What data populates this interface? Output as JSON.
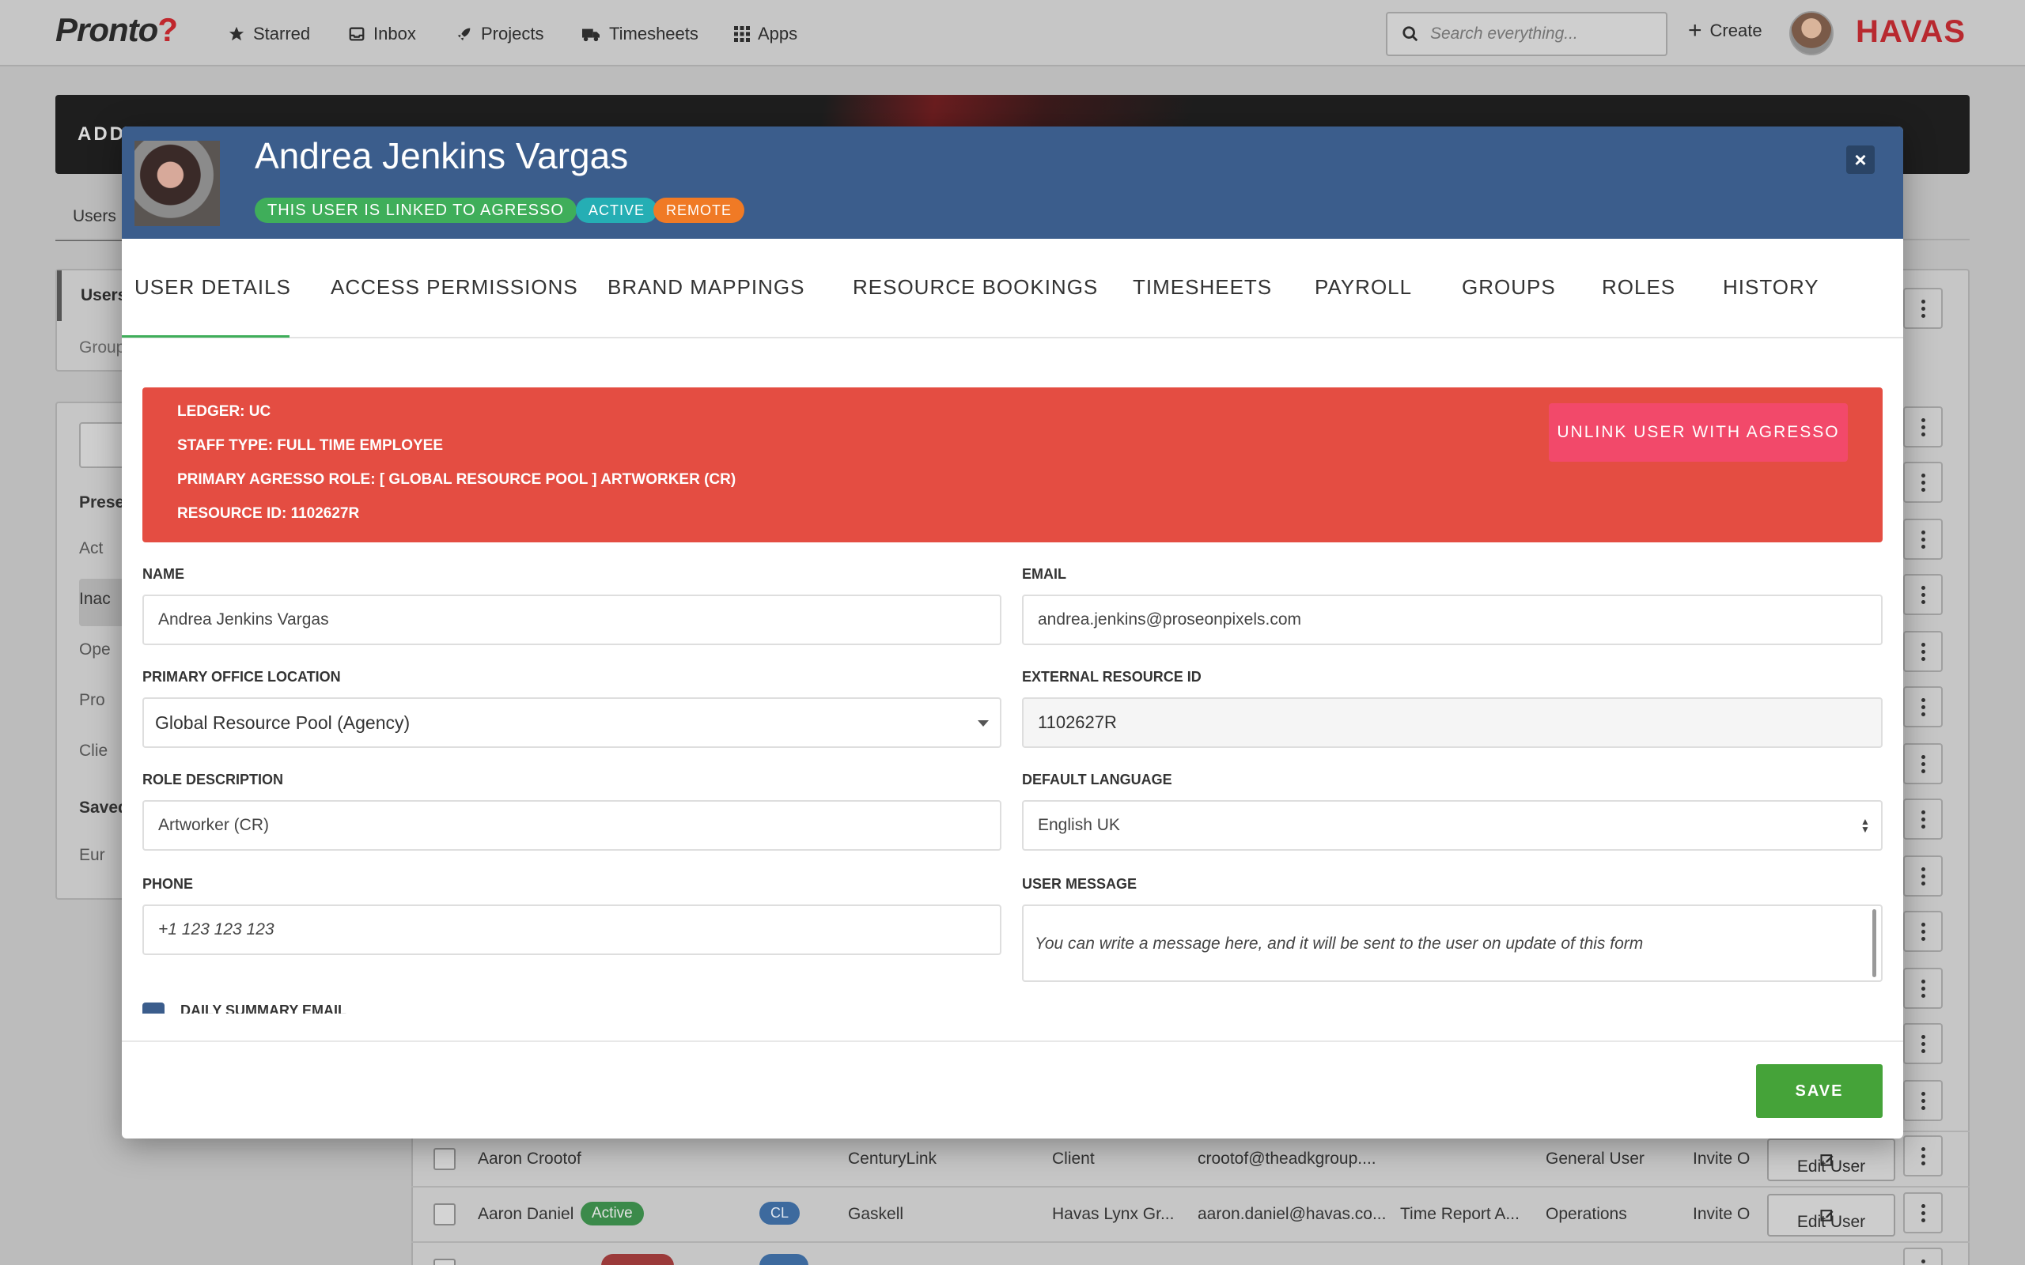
{
  "topnav": {
    "logo": "Pronto",
    "logo_mark": "?",
    "items": [
      {
        "label": "Starred",
        "icon": "star-icon"
      },
      {
        "label": "Inbox",
        "icon": "inbox-icon"
      },
      {
        "label": "Projects",
        "icon": "rocket-icon"
      },
      {
        "label": "Timesheets",
        "icon": "truck-icon"
      },
      {
        "label": "Apps",
        "icon": "grid-icon"
      }
    ],
    "search_placeholder": "Search everything...",
    "create_label": "Create",
    "brand": "HAVAS"
  },
  "background": {
    "banner_text": "ADD",
    "tab_label": "Users",
    "side_users": "Users",
    "side_groups": "Group",
    "side_items": [
      "Prese",
      "Act",
      "Inac",
      "Ope",
      "Pro",
      "Clie",
      "Saved",
      "Eur"
    ],
    "rows": [
      {
        "name": "Aaron Crootof",
        "badge": "",
        "code": "",
        "company": "CenturyLink",
        "type": "Client",
        "email": "crootof@theadkgroup....",
        "report": "",
        "role": "General User",
        "invite": "Invite O",
        "edit": "Edit User"
      },
      {
        "name": "Aaron Daniel",
        "badge": "Active",
        "code": "CL",
        "company": "Gaskell",
        "type": "Havas Lynx Gr...",
        "email": "aaron.daniel@havas.co...",
        "report": "Time Report A...",
        "role": "Operations",
        "invite": "Invite O",
        "edit": "Edit User"
      }
    ]
  },
  "modal": {
    "title": "Andrea Jenkins Vargas",
    "badges": {
      "agresso": "THIS USER IS LINKED TO AGRESSO",
      "active": "ACTIVE",
      "remote": "REMOTE"
    },
    "close": "×",
    "tabs": [
      "USER DETAILS",
      "ACCESS PERMISSIONS",
      "BRAND MAPPINGS",
      "RESOURCE BOOKINGS",
      "TIMESHEETS",
      "PAYROLL",
      "GROUPS",
      "ROLES",
      "HISTORY"
    ],
    "active_tab": "USER DETAILS",
    "alert": {
      "lines": [
        "LEDGER: UC",
        "STAFF TYPE: FULL TIME EMPLOYEE",
        "PRIMARY AGRESSO ROLE: [ GLOBAL RESOURCE POOL ] ARTWORKER (CR)",
        "RESOURCE ID: 1102627R"
      ],
      "button": "UNLINK USER WITH AGRESSO"
    },
    "form": {
      "name": {
        "label": "NAME",
        "value": "Andrea Jenkins Vargas"
      },
      "email": {
        "label": "EMAIL",
        "value": "andrea.jenkins@proseonpixels.com"
      },
      "office": {
        "label": "PRIMARY OFFICE LOCATION",
        "value": "Global Resource Pool (Agency)"
      },
      "external_id": {
        "label": "EXTERNAL RESOURCE ID",
        "value": "1102627R"
      },
      "role_description": {
        "label": "ROLE DESCRIPTION",
        "value": "Artworker (CR)"
      },
      "language": {
        "label": "DEFAULT LANGUAGE",
        "value": "English UK"
      },
      "phone": {
        "label": "PHONE",
        "placeholder": "+1 123 123 123"
      },
      "message": {
        "label": "USER MESSAGE",
        "placeholder": "You can write a message here, and it will be sent to the user on update of this form"
      },
      "daily_summary": {
        "label": "DAILY SUMMARY EMAIL",
        "checked": true
      }
    },
    "save": "SAVE"
  },
  "colors": {
    "header_blue": "#3b5d8c",
    "alert_red": "#e44d42",
    "unlink_pink": "#f2496a",
    "save_green": "#45a339",
    "agresso_green": "#3fae5a",
    "active_teal": "#25aeb4",
    "remote_orange": "#f07a25",
    "brand_red": "#b8292f"
  }
}
